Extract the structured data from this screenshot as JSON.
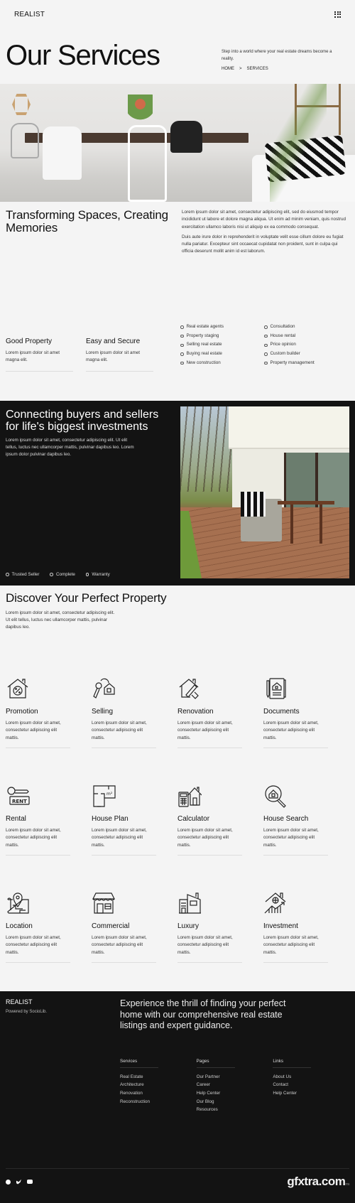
{
  "header": {
    "logo": "REALIST",
    "menu_icon": "grid-menu-icon"
  },
  "hero": {
    "title": "Our Services",
    "tagline": "Step into a world where your real estate dreams become a reality.",
    "breadcrumb": {
      "home": "HOME",
      "separator": ">",
      "current": "SERVICES"
    }
  },
  "banner": {
    "alt": "Modern dining room interior"
  },
  "transform": {
    "title": "Transforming Spaces, Creating Memories",
    "paragraph1": "Lorem ipsum dolor sit amet, consectetur adipiscing elit, sed do eiusmod tempor incididunt ut labore et dolore magna aliqua. Ut enim ad minim veniam, quis nostrud exercitation ullamco laboris nisi ut aliquip ex ea commodo consequat.",
    "paragraph2": "Duis aute irure dolor in reprehenderit in voluptate velit esse cillum dolore eu fugiat nulla pariatur. Excepteur sint occaecat cupidatat non proident, sunt in culpa qui officia deserunt mollit anim id est laborum."
  },
  "features": [
    {
      "title": "Good Property",
      "text": "Lorem ipsum dolor sit amet magna elit."
    },
    {
      "title": "Easy and Secure",
      "text": "Lorem ipsum dolor sit amet magna elit."
    }
  ],
  "service_lists": [
    [
      "Real estate agents",
      "Property staging",
      "Selling real estate",
      "Buying real estate",
      "New construction"
    ],
    [
      "Consultation",
      "House rental",
      "Price opinion",
      "Custom builder",
      "Property management"
    ]
  ],
  "connect": {
    "title": "Connecting buyers and sellers for life's biggest investments",
    "text": "Lorem ipsum dolor sit amet, consectetur adipiscing elit. Ut elit tellus, luctus nec ullamcorper mattis, pulvinar dapibus leo. Lorem ipsum dolor pulvinar dapibus leo.",
    "badges": [
      "Trusted Seller",
      "Complete",
      "Warranty"
    ]
  },
  "discover": {
    "title": "Discover Your Perfect Property",
    "text": "Lorem ipsum dolor sit amet, consectetur adipiscing elit. Ut elit tellus, luctus nec ullamcorper mattis, pulvinar dapibus leo."
  },
  "services": [
    {
      "title": "Promotion",
      "icon": "house-percent-icon",
      "text": "Lorem ipsum dolor sit amet, consectetur adipiscing elit mattis."
    },
    {
      "title": "Selling",
      "icon": "house-key-icon",
      "text": "Lorem ipsum dolor sit amet, consectetur adipiscing elit mattis."
    },
    {
      "title": "Renovation",
      "icon": "house-brush-icon",
      "text": "Lorem ipsum dolor sit amet, consectetur adipiscing elit mattis."
    },
    {
      "title": "Documents",
      "icon": "document-house-icon",
      "text": "Lorem ipsum dolor sit amet, consectetur adipiscing elit mattis."
    },
    {
      "title": "Rental",
      "icon": "rent-key-icon",
      "text": "Lorem ipsum dolor sit amet, consectetur adipiscing elit mattis."
    },
    {
      "title": "House Plan",
      "icon": "floor-plan-icon",
      "text": "Lorem ipsum dolor sit amet, consectetur adipiscing elit mattis."
    },
    {
      "title": "Calculator",
      "icon": "calculator-house-icon",
      "text": "Lorem ipsum dolor sit amet, consectetur adipiscing elit mattis."
    },
    {
      "title": "House Search",
      "icon": "house-search-icon",
      "text": "Lorem ipsum dolor sit amet, consectetur adipiscing elit mattis."
    },
    {
      "title": "Location",
      "icon": "map-pin-icon",
      "text": "Lorem ipsum dolor sit amet, consectetur adipiscing elit mattis."
    },
    {
      "title": "Commercial",
      "icon": "storefront-icon",
      "text": "Lorem ipsum dolor sit amet, consectetur adipiscing elit mattis."
    },
    {
      "title": "Luxury",
      "icon": "luxury-house-icon",
      "text": "Lorem ipsum dolor sit amet, consectetur adipiscing elit mattis."
    },
    {
      "title": "Investment",
      "icon": "house-growth-icon",
      "text": "Lorem ipsum dolor sit amet, consectetur adipiscing elit mattis."
    }
  ],
  "footer": {
    "brand": "REALIST",
    "powered": "Powered by SocioLib.",
    "tagline": "Experience the thrill of finding your perfect home with our comprehensive real estate listings and expert guidance.",
    "columns": [
      {
        "title": "Services",
        "links": [
          "Real Estate",
          "Architecture",
          "Renovation",
          "Reconstruction"
        ]
      },
      {
        "title": "Pages",
        "links": [
          "Our Partner",
          "Career",
          "Help Center",
          "Our Blog",
          "Resources"
        ]
      },
      {
        "title": "Links",
        "links": [
          "About Us",
          "Contact",
          "Help Center"
        ]
      }
    ],
    "socials": [
      "facebook-icon",
      "twitter-icon",
      "youtube-icon"
    ],
    "watermark": "gfxtra.com",
    "watermark_suffix": "ms"
  }
}
